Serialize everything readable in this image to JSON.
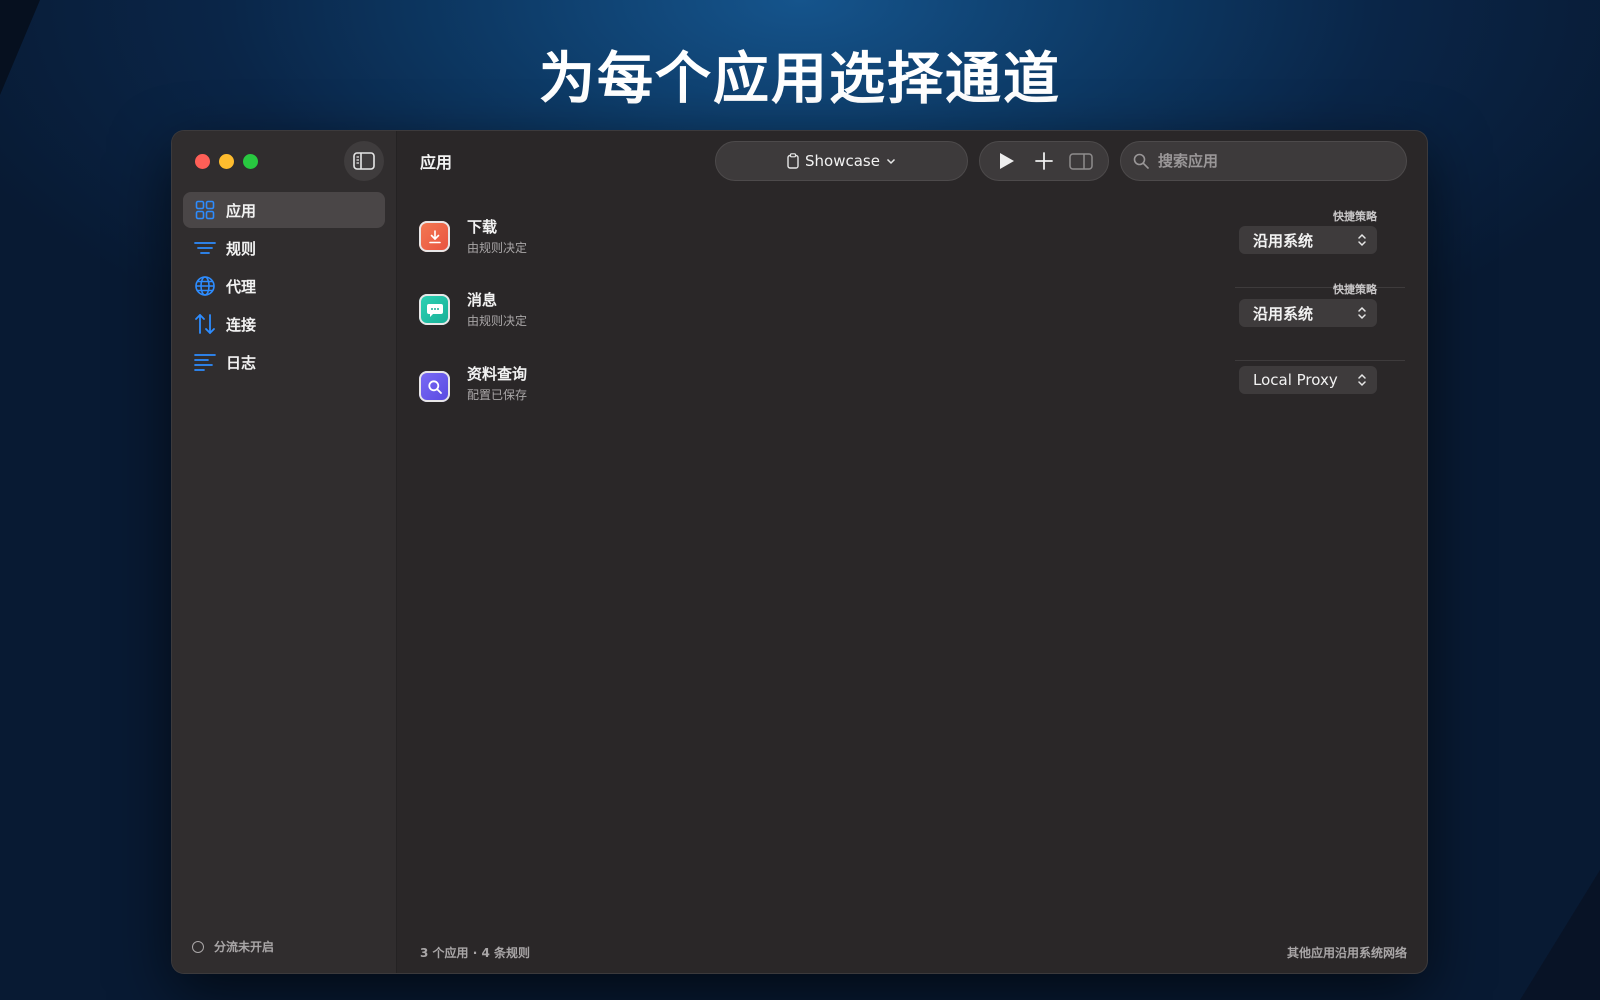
{
  "hero": {
    "title": "为每个应用选择通道"
  },
  "sidebar": {
    "items": [
      {
        "label": "应用",
        "icon": "grid-icon"
      },
      {
        "label": "规则",
        "icon": "list-icon"
      },
      {
        "label": "代理",
        "icon": "globe-icon"
      },
      {
        "label": "连接",
        "icon": "arrows-updown-icon"
      },
      {
        "label": "日志",
        "icon": "log-lines-icon"
      }
    ],
    "status": "分流未开启"
  },
  "toolbar": {
    "title": "应用",
    "profile": "Showcase",
    "search_placeholder": "搜索应用"
  },
  "apps": [
    {
      "name": "下载",
      "subtitle": "由规则决定",
      "policy_label": "快捷策略",
      "policy": "沿用系统"
    },
    {
      "name": "消息",
      "subtitle": "由规则决定",
      "policy_label": "快捷策略",
      "policy": "沿用系统"
    },
    {
      "name": "资料查询",
      "subtitle": "配置已保存",
      "policy": "Local Proxy"
    }
  ],
  "footer": {
    "left": "3 个应用 · 4 条规则",
    "right": "其他应用沿用系统网络"
  },
  "colors": {
    "accent": "#2d8cff",
    "download_icon": "#f0694a",
    "message_icon": "#1fbfa3",
    "lookup_icon": "#6a5cf0"
  }
}
